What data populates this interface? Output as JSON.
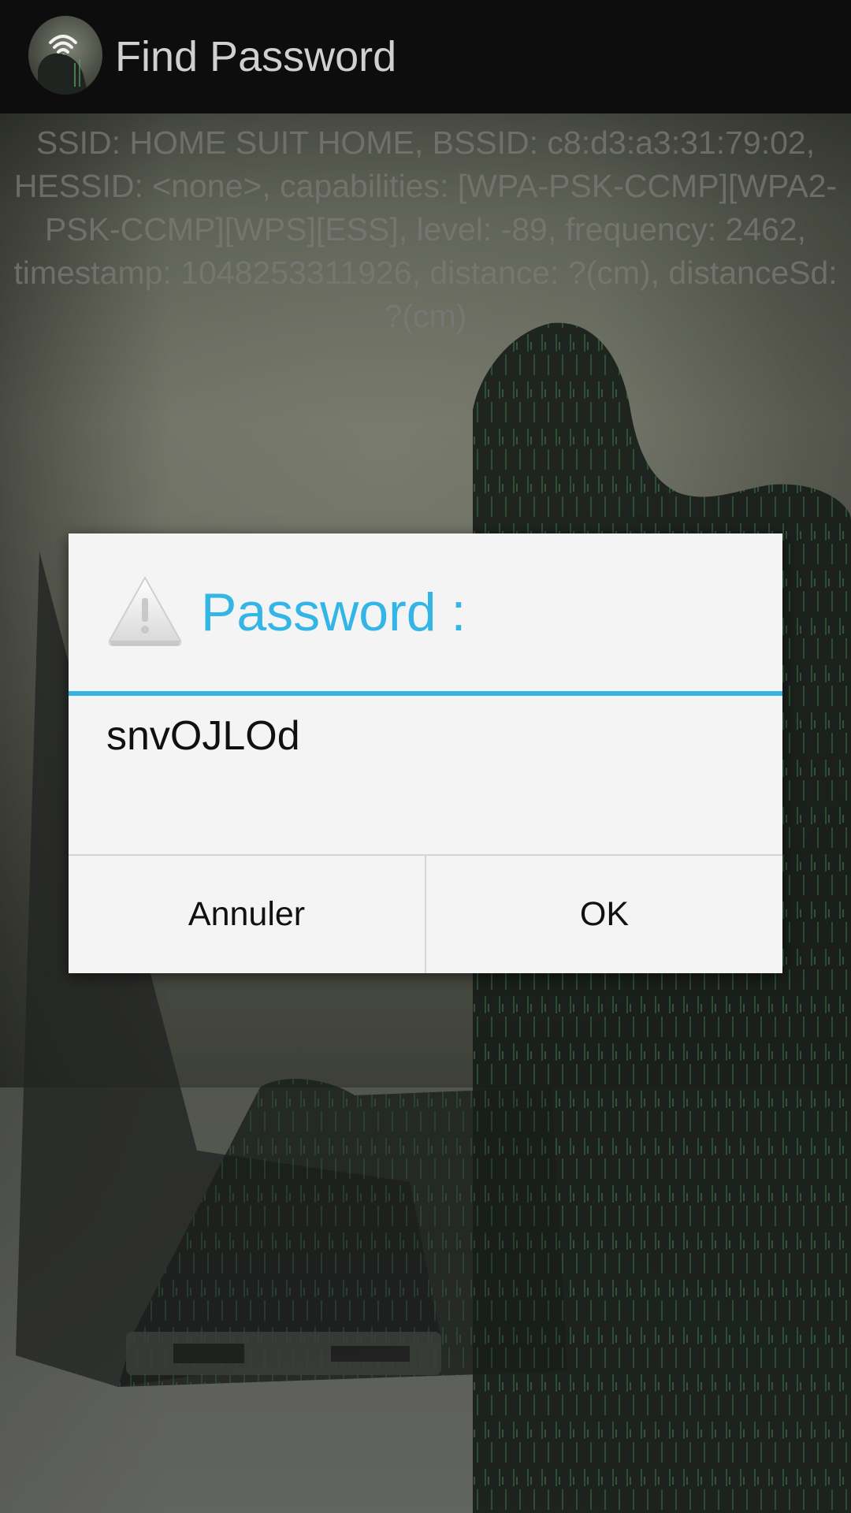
{
  "actionbar": {
    "title": "Find Password"
  },
  "wifi_info": {
    "text": "SSID: HOME SUIT HOME, BSSID: c8:d3:a3:31:79:02, HESSID: <none>, capabilities: [WPA-PSK-CCMP][WPA2-PSK-CCMP][WPS][ESS], level: -89, frequency: 2462, timestamp: 1048253311926, distance: ?(cm), distanceSd: ?(cm)"
  },
  "dialog": {
    "title": "Password :",
    "message": "snvOJLOd",
    "icon": "warning-icon",
    "buttons": {
      "cancel_label": "Annuler",
      "ok_label": "OK"
    }
  },
  "colors": {
    "accent": "#33b5e5",
    "actionbar_bg": "#0d0d0d",
    "dialog_bg": "#f4f4f4"
  }
}
